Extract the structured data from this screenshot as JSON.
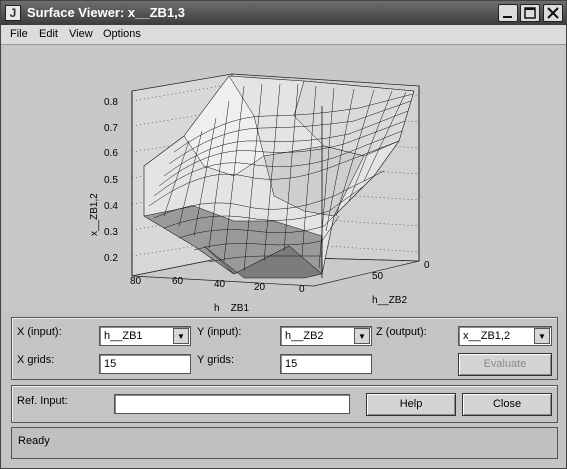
{
  "window": {
    "title": "Surface Viewer: x__ZB1,3"
  },
  "menu": [
    "File",
    "Edit",
    "View",
    "Options"
  ],
  "plot": {
    "z_ticks": [
      "0.8",
      "0.7",
      "0.6",
      "0.5",
      "0.4",
      "0.3",
      "0.2"
    ],
    "z_label": "x__ZB1,2",
    "x_ticks": [
      "80",
      "60",
      "40",
      "20",
      "0"
    ],
    "x_label": "h__ZB1",
    "y_ticks": [
      "50",
      "0"
    ],
    "y_label": "h__ZB2"
  },
  "controls": {
    "x_input_label": "X (input):",
    "x_input_value": "h__ZB1",
    "y_input_label": "Y (input):",
    "y_input_value": "h__ZB2",
    "z_output_label": "Z (output):",
    "z_output_value": "x__ZB1,2",
    "x_grids_label": "X grids:",
    "x_grids_value": "15",
    "y_grids_label": "Y grids:",
    "y_grids_value": "15",
    "evaluate_label": "Evaluate",
    "ref_input_label": "Ref. Input:",
    "ref_input_value": "",
    "help_label": "Help",
    "close_label": "Close"
  },
  "status": "Ready"
}
